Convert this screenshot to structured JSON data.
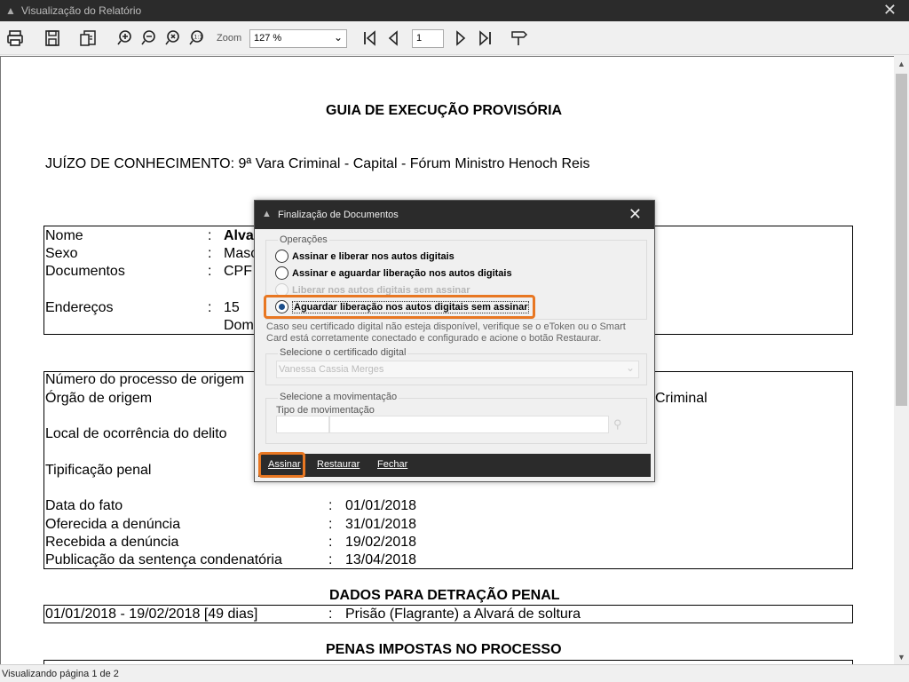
{
  "window": {
    "title": "Visualização do Relatório"
  },
  "toolbar": {
    "zoom_label": "Zoom",
    "zoom_value": "127 %",
    "page_value": "1"
  },
  "report": {
    "title": "GUIA DE EXECUÇÃO PROVISÓRIA",
    "juizo": "JUÍZO DE CONHECIMENTO: 9ª Vara Criminal - Capital - Fórum Ministro Henoch Reis",
    "person": {
      "labels": [
        "Nome",
        "Sexo",
        "Documentos",
        "Endereços"
      ],
      "sep": ":",
      "values_partial": [
        "Alvar",
        "Masc",
        "CPF",
        "15",
        "Dom"
      ]
    },
    "process": {
      "labels": [
        "Número do processo de origem",
        "Órgão de origem",
        "Local de ocorrência do delito",
        "Tipificação penal"
      ],
      "orgao_partial": "Criminal",
      "dates": [
        {
          "label": "Data do fato",
          "value": "01/01/2018"
        },
        {
          "label": "Oferecida a denúncia",
          "value": "31/01/2018"
        },
        {
          "label": "Recebida a denúncia",
          "value": "19/02/2018"
        },
        {
          "label": "Publicação da sentença condenatória",
          "value": "13/04/2018"
        }
      ]
    },
    "detracao": {
      "heading": "DADOS PARA DETRAÇÃO PENAL",
      "period": "01/01/2018 - 19/02/2018 [49 dias]",
      "desc": "Prisão (Flagrante) a Alvará de soltura"
    },
    "penas": {
      "heading": "PENAS IMPOSTAS NO PROCESSO"
    }
  },
  "status": {
    "text": "Visualizando página 1 de 2"
  },
  "dialog": {
    "title": "Finalização de Documentos",
    "operacoes_legend": "Operações",
    "options": [
      {
        "label": "Assinar e liberar nos autos digitais",
        "checked": false,
        "disabled": false
      },
      {
        "label": "Assinar e aguardar liberação nos autos digitais",
        "checked": false,
        "disabled": false
      },
      {
        "label": "Liberar nos autos digitais sem assinar",
        "checked": false,
        "disabled": true
      },
      {
        "label": "Aguardar liberação nos autos digitais sem assinar",
        "checked": true,
        "disabled": false
      }
    ],
    "help_text": "Caso seu certificado digital não esteja disponível, verifique se o eToken ou o Smart Card está corretamente conectado e configurado e acione o botão Restaurar.",
    "cert_legend": "Selecione o certificado digital",
    "cert_value": "Vanessa Cassia Merges",
    "mov_legend": "Selecione a movimentação",
    "mov_type_label": "Tipo de movimentação",
    "buttons": {
      "sign": "Assinar",
      "restore": "Restaurar",
      "close": "Fechar"
    }
  },
  "colors": {
    "highlight": "#e87722",
    "titlebar": "#2b2b2b"
  }
}
